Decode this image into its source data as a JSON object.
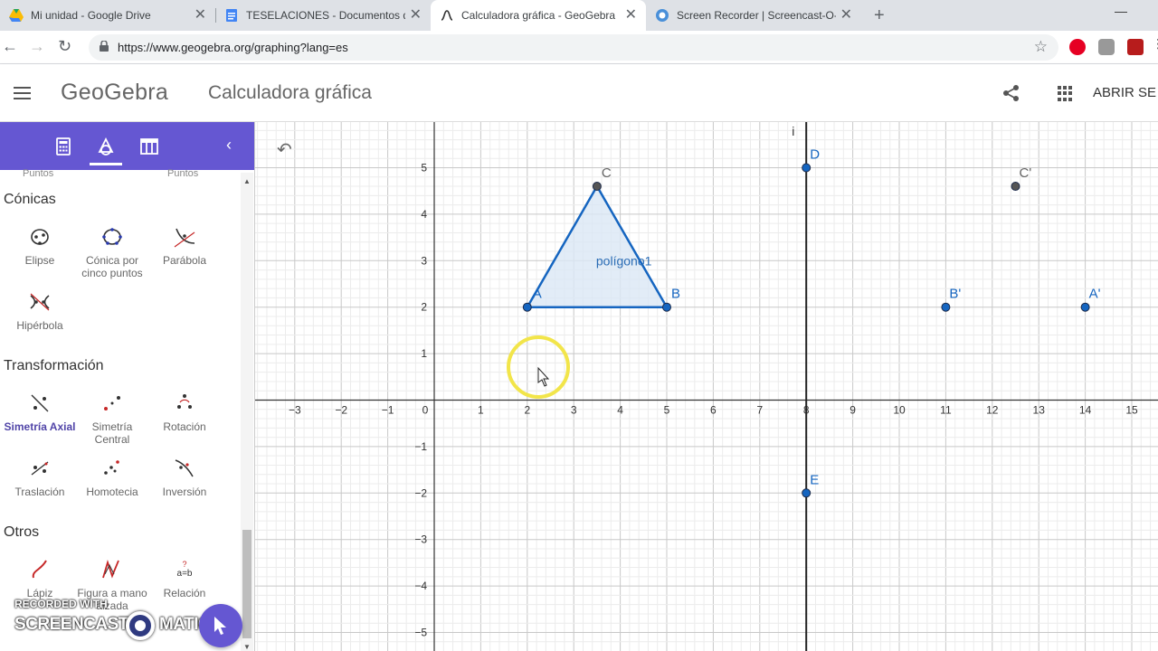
{
  "browser": {
    "tabs": [
      {
        "title": "Mi unidad - Google Drive",
        "icon": "drive-icon"
      },
      {
        "title": "TESELACIONES - Documentos de",
        "icon": "docs-icon"
      },
      {
        "title": "Calculadora gráfica - GeoGebra",
        "icon": "geogebra-icon"
      },
      {
        "title": "Screen Recorder | Screencast-O-M",
        "icon": "screencast-icon"
      }
    ],
    "url": "https://www.geogebra.org/graphing?lang=es"
  },
  "header": {
    "logo": "GeoGebra",
    "title": "Calculadora gráfica",
    "signin": "ABRIR SE"
  },
  "panel": {
    "cut_labels": [
      "Puntos",
      "Puntos"
    ],
    "sections": [
      {
        "title": "Cónicas",
        "tools": [
          "Elipse",
          "Cónica por cinco puntos",
          "Parábola",
          "Hipérbola"
        ]
      },
      {
        "title": "Transformación",
        "tools": [
          "Simetría Axial",
          "Simetría Central",
          "Rotación",
          "Traslación",
          "Homotecia",
          "Inversión"
        ]
      },
      {
        "title": "Otros",
        "tools": [
          "Lápiz",
          "Figura a mano alzada",
          "Relación"
        ]
      }
    ],
    "selected_tool": "Simetría Axial"
  },
  "watermark": {
    "line1": "RECORDED WITH",
    "line2a": "SCREENCAST",
    "line2b": "MATIC"
  },
  "graph": {
    "x_ticks": [
      "−3",
      "−2",
      "−1",
      "0",
      "1",
      "2",
      "3",
      "4",
      "5",
      "6",
      "7",
      "8",
      "9",
      "10",
      "11",
      "12",
      "13",
      "14",
      "15"
    ],
    "y_ticks": [
      "5",
      "4",
      "3",
      "2",
      "1",
      "−1",
      "−2",
      "−3",
      "−4",
      "−5"
    ],
    "points": [
      {
        "label": "A",
        "x": 2,
        "y": 2
      },
      {
        "label": "B",
        "x": 5,
        "y": 2
      },
      {
        "label": "C",
        "x": 3.5,
        "y": 4.6
      },
      {
        "label": "D",
        "x": 8,
        "y": 5
      },
      {
        "label": "E",
        "x": 8,
        "y": -2
      },
      {
        "label": "A'",
        "x": 14,
        "y": 2
      },
      {
        "label": "B'",
        "x": 11,
        "y": 2
      },
      {
        "label": "C'",
        "x": 12.5,
        "y": 4.6
      }
    ],
    "polygon_label": "polígono1",
    "line_label": "i",
    "mirror_line_x": 8,
    "colors": {
      "point": "#1565c0",
      "polygon": "#1565c0",
      "fill": "#dbe7f5",
      "line": "#222222",
      "gray_point": "#555555"
    }
  }
}
